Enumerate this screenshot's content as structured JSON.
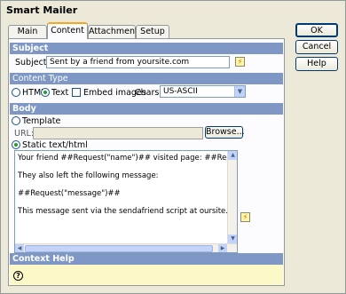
{
  "window": {
    "title": "Smart Mailer"
  },
  "tabs": [
    {
      "label": "Main"
    },
    {
      "label": "Content"
    },
    {
      "label": "Attachments"
    },
    {
      "label": "Setup"
    }
  ],
  "subject_section": {
    "header": "Subject",
    "label": "Subject:",
    "value": "Sent by a friend from yoursite.com"
  },
  "content_type_section": {
    "header": "Content Type",
    "html_label": "HTML",
    "text_label": "Text",
    "embed_images_label": "Embed images",
    "charset_label": "Charset:",
    "charset_value": "US-ASCII"
  },
  "body_section": {
    "header": "Body",
    "template_label": "Template",
    "url_label": "URL:",
    "url_value": "",
    "browse_label": "Browse...",
    "static_label": "Static text/html",
    "content_lines": [
      "Your friend ##Request(\"name\")## visited page: ##Request(\"url\")##",
      "They also left the following message:",
      "##Request(\"message\")##",
      "This message sent via the sendafriend script at oursite.com. Report abuse of"
    ]
  },
  "context_help": {
    "header": "Context Help",
    "icon": "question-icon"
  },
  "buttons": {
    "ok": "OK",
    "cancel": "Cancel",
    "help": "Help"
  },
  "colors": {
    "section_header": "#7e97c4",
    "help_bg": "#fdf8c8",
    "tab_accent": "#f5a623"
  }
}
